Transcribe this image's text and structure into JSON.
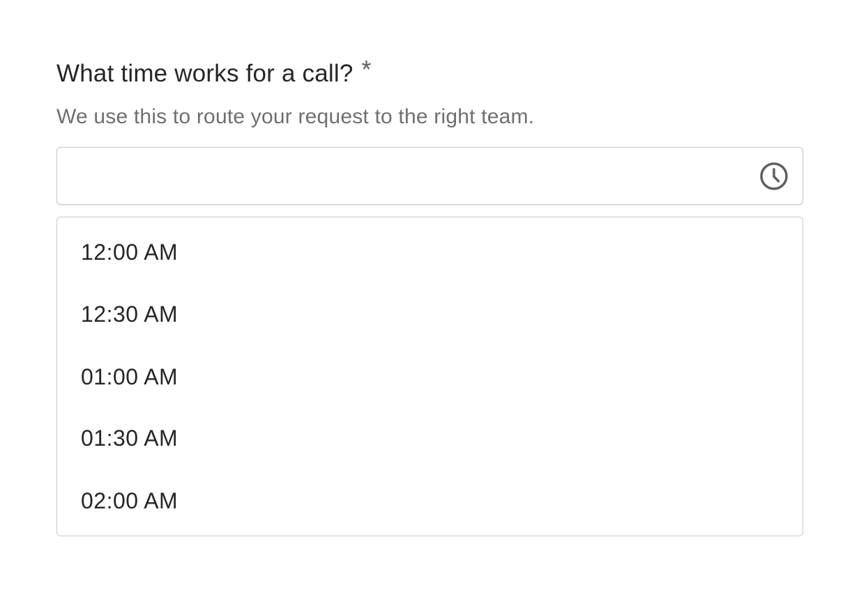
{
  "field": {
    "label": "What time works for a call?",
    "required_marker": "*",
    "helper_text": "We use this to route your request to the right team.",
    "input_value": "",
    "input_placeholder": "",
    "icon": "clock-icon"
  },
  "dropdown": {
    "options": [
      {
        "label": "12:00 AM"
      },
      {
        "label": "12:30 AM"
      },
      {
        "label": "01:00 AM"
      },
      {
        "label": "01:30 AM"
      },
      {
        "label": "02:00 AM"
      }
    ]
  },
  "colors": {
    "text_primary": "#262626",
    "text_secondary": "#6f6f6f",
    "border": "#c8c8c8",
    "icon": "#5f5f5f"
  }
}
